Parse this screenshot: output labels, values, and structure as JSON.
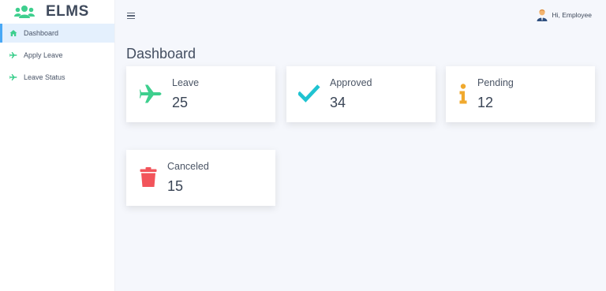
{
  "brand": {
    "title": "ELMS"
  },
  "sidebar": {
    "items": [
      {
        "label": "Dashboard",
        "icon": "home-icon",
        "active": true
      },
      {
        "label": "Apply Leave",
        "icon": "plane-icon",
        "active": false
      },
      {
        "label": "Leave Status",
        "icon": "plane-icon",
        "active": false
      }
    ]
  },
  "header": {
    "greeting": "Hi, Employee"
  },
  "main": {
    "title": "Dashboard",
    "cards": [
      {
        "label": "Leave",
        "count": "25",
        "icon": "plane-icon",
        "color": "#3ecf8e"
      },
      {
        "label": "Approved",
        "count": "34",
        "icon": "check-icon",
        "color": "#1fc3d1"
      },
      {
        "label": "Pending",
        "count": "12",
        "icon": "info-icon",
        "color": "#f0a92e"
      },
      {
        "label": "Canceled",
        "count": "15",
        "icon": "trash-icon",
        "color": "#f2545b"
      }
    ]
  },
  "colors": {
    "accent": "#49a8f5",
    "brand_green": "#3ecf8e",
    "background": "#f5f7fc"
  }
}
